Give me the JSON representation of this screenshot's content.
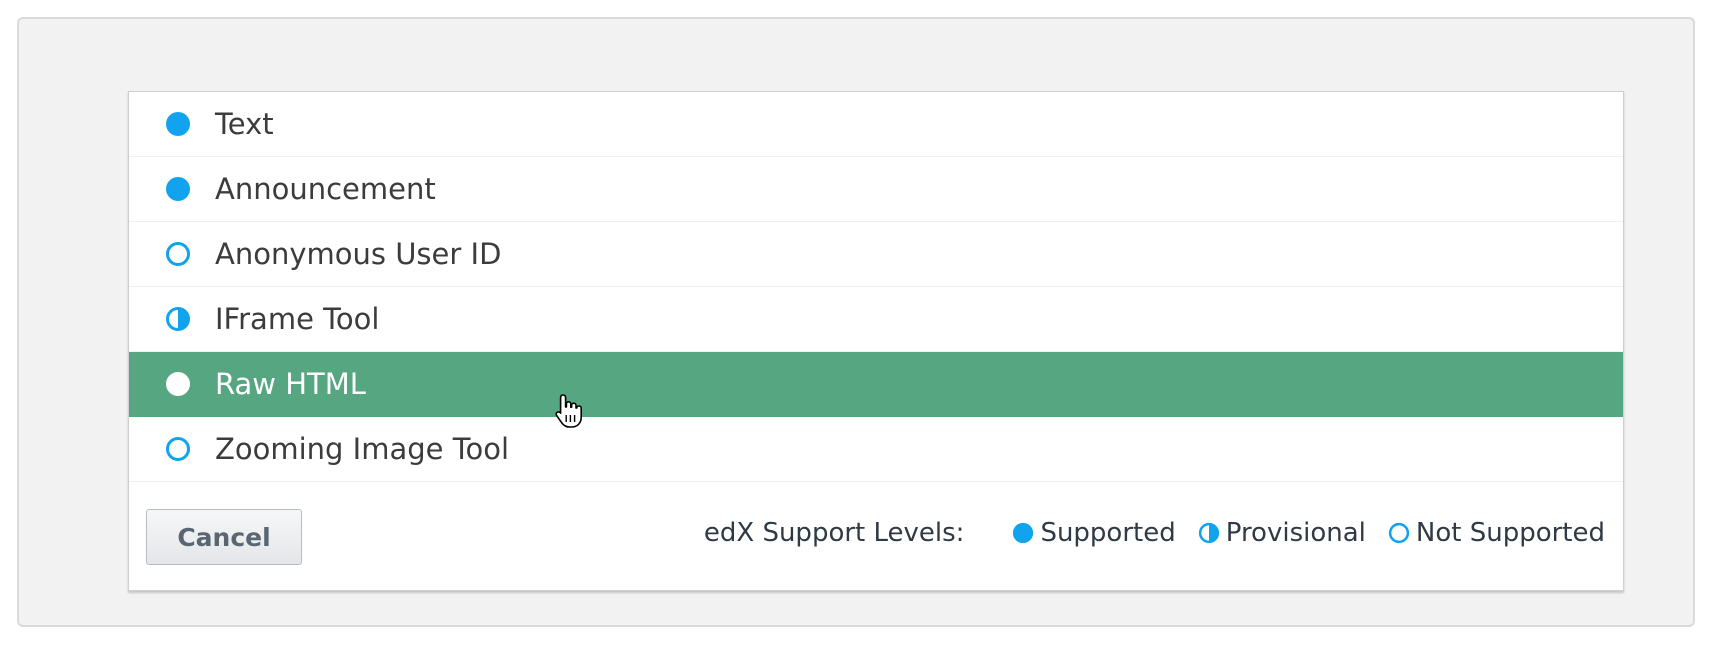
{
  "components": [
    {
      "label": "Text",
      "support": "supported",
      "selected": false
    },
    {
      "label": "Announcement",
      "support": "supported",
      "selected": false
    },
    {
      "label": "Anonymous User ID",
      "support": "not-supported",
      "selected": false
    },
    {
      "label": "IFrame Tool",
      "support": "provisional",
      "selected": false
    },
    {
      "label": "Raw HTML",
      "support": "supported",
      "selected": true
    },
    {
      "label": "Zooming Image Tool",
      "support": "not-supported",
      "selected": false
    }
  ],
  "footer": {
    "cancel_label": "Cancel",
    "legend_title": "edX Support Levels:",
    "legend": {
      "supported": "Supported",
      "provisional": "Provisional",
      "not_supported": "Not Supported"
    }
  },
  "colors": {
    "support_blue": "#11a3ee",
    "hover_green": "#56a682",
    "text": "#3c3c3c"
  },
  "icons": {
    "supported": "filled-circle-icon",
    "provisional": "half-circle-icon",
    "not_supported": "outline-circle-icon",
    "cursor": "hand-pointer-icon"
  }
}
